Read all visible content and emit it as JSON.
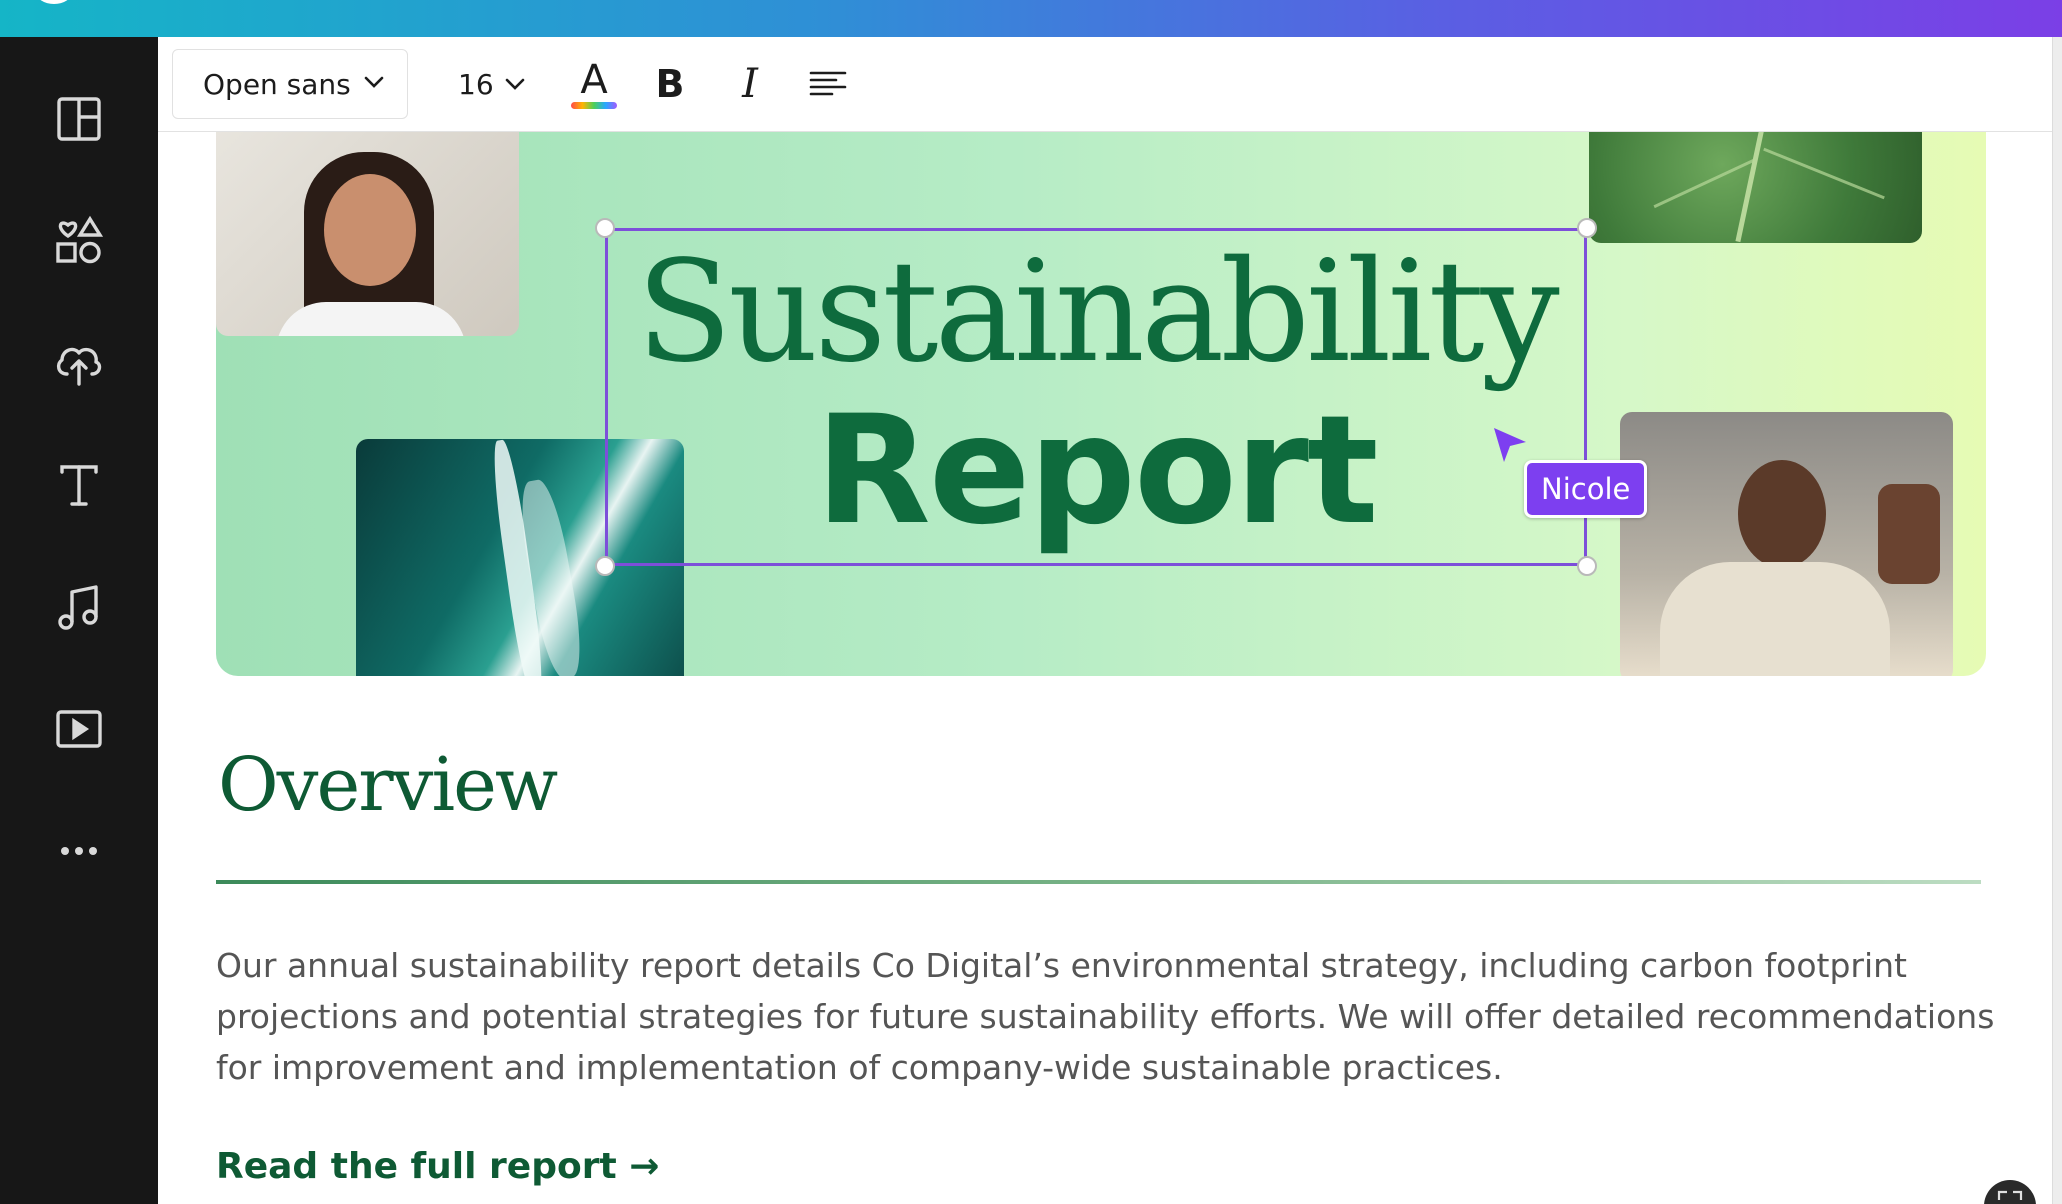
{
  "toolbar": {
    "font_family": "Open sans",
    "font_size": "16",
    "text_color_label": "A",
    "bold_label": "B",
    "italic_label": "I",
    "icons": [
      "chevron-down-icon",
      "text-color-icon",
      "bold-icon",
      "italic-icon",
      "align-left-icon"
    ]
  },
  "sidebar": {
    "items": [
      {
        "icon": "layout-icon"
      },
      {
        "icon": "elements-icon"
      },
      {
        "icon": "upload-icon"
      },
      {
        "icon": "text-icon"
      },
      {
        "icon": "music-icon"
      },
      {
        "icon": "video-icon"
      },
      {
        "icon": "more-icon"
      }
    ]
  },
  "hero": {
    "title_line1": "Sustainability",
    "title_line2": "Report",
    "collaborator": "Nicole",
    "selection_color": "#7d4fd9"
  },
  "content": {
    "heading": "Overview",
    "body": "Our annual sustainability report details Co Digital’s environmental strategy, including carbon footprint projections and potential strategies for future sustainability efforts. We will offer detailed recommendations for improvement and implementation of company-wide sustainable practices.",
    "link": "Read the full report →"
  },
  "colors": {
    "brand_green": "#0e6b3d",
    "accent_purple": "#7d3ff0",
    "sidebar_bg": "#171717"
  }
}
